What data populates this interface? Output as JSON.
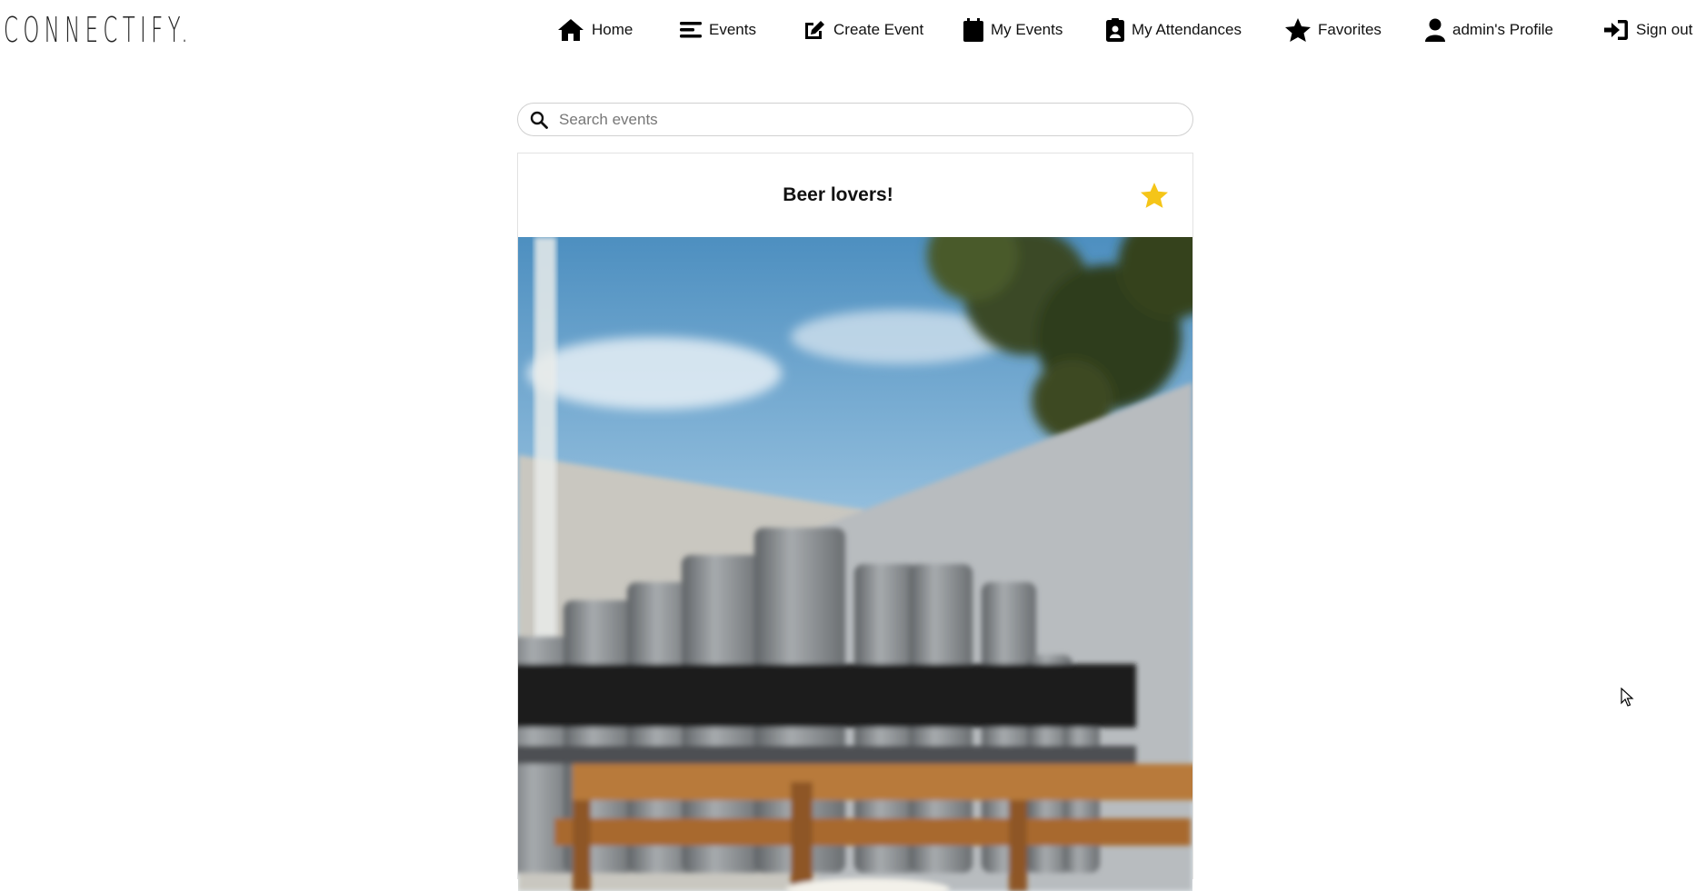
{
  "brand": {
    "name": "CONNECTIFY."
  },
  "nav": {
    "home": "Home",
    "events": "Events",
    "create_event": "Create Event",
    "my_events": "My Events",
    "my_attendances": "My Attendances",
    "favorites": "Favorites",
    "profile": "admin's Profile",
    "sign_out": "Sign out"
  },
  "search": {
    "placeholder": "Search events",
    "value": ""
  },
  "event_card": {
    "title": "Beer lovers!",
    "favorite_icon": "star-icon",
    "favorite_color": "#f5c518"
  },
  "icons": {
    "home": "home-icon",
    "events": "list-icon",
    "create_event": "edit-icon",
    "my_events": "calendar-icon",
    "my_attendances": "badge-icon",
    "favorites": "star-icon",
    "profile": "user-icon",
    "sign_out": "sign-in-icon",
    "search": "search-icon"
  }
}
